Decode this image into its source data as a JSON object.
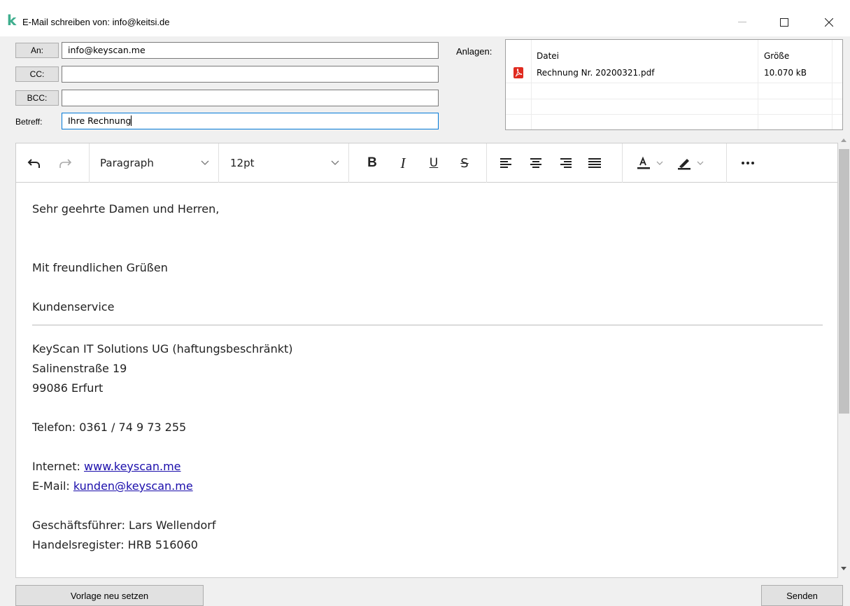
{
  "window": {
    "title": "E-Mail schreiben von: info@keitsi.de"
  },
  "header": {
    "to_label": "An:",
    "to_value": "info@keyscan.me",
    "cc_label": "CC:",
    "cc_value": "",
    "bcc_label": "BCC:",
    "bcc_value": "",
    "subject_label": "Betreff:",
    "subject_value": "Ihre Rechnung",
    "attachments_label": "Anlagen:"
  },
  "attachments": {
    "columns": [
      "Datei",
      "Größe"
    ],
    "rows": [
      {
        "icon": "pdf-icon",
        "name": "Rechnung Nr. 20200321.pdf",
        "size": "10.070 kB"
      }
    ]
  },
  "toolbar": {
    "block_format": "Paragraph",
    "font_size": "12pt",
    "bold": "B",
    "italic": "I",
    "underline": "U",
    "strike": "S"
  },
  "body": {
    "greeting": "Sehr geehrte Damen und Herren,",
    "closing": "Mit freundlichen Grüßen",
    "team": "Kundenservice",
    "company": "KeyScan IT Solutions UG (haftungsbeschränkt)",
    "street": "Salinenstraße 19",
    "city": "99086 Erfurt",
    "phone": "Telefon: 0361 / 74 9 73 255",
    "internet_label": "Internet: ",
    "internet_link": "www.keyscan.me",
    "email_label": "E-Mail: ",
    "email_link": "kunden@keyscan.me",
    "ceo": "Geschäftsführer: Lars Wellendorf",
    "register_partial": "Handelsregister: HRB 516060"
  },
  "footer": {
    "reset_label": "Vorlage neu setzen",
    "send_label": "Senden"
  },
  "colors": {
    "accent": "#0078d7",
    "link": "#1a0dab",
    "logo": "#3fae8e",
    "pdf": "#e02b20"
  }
}
